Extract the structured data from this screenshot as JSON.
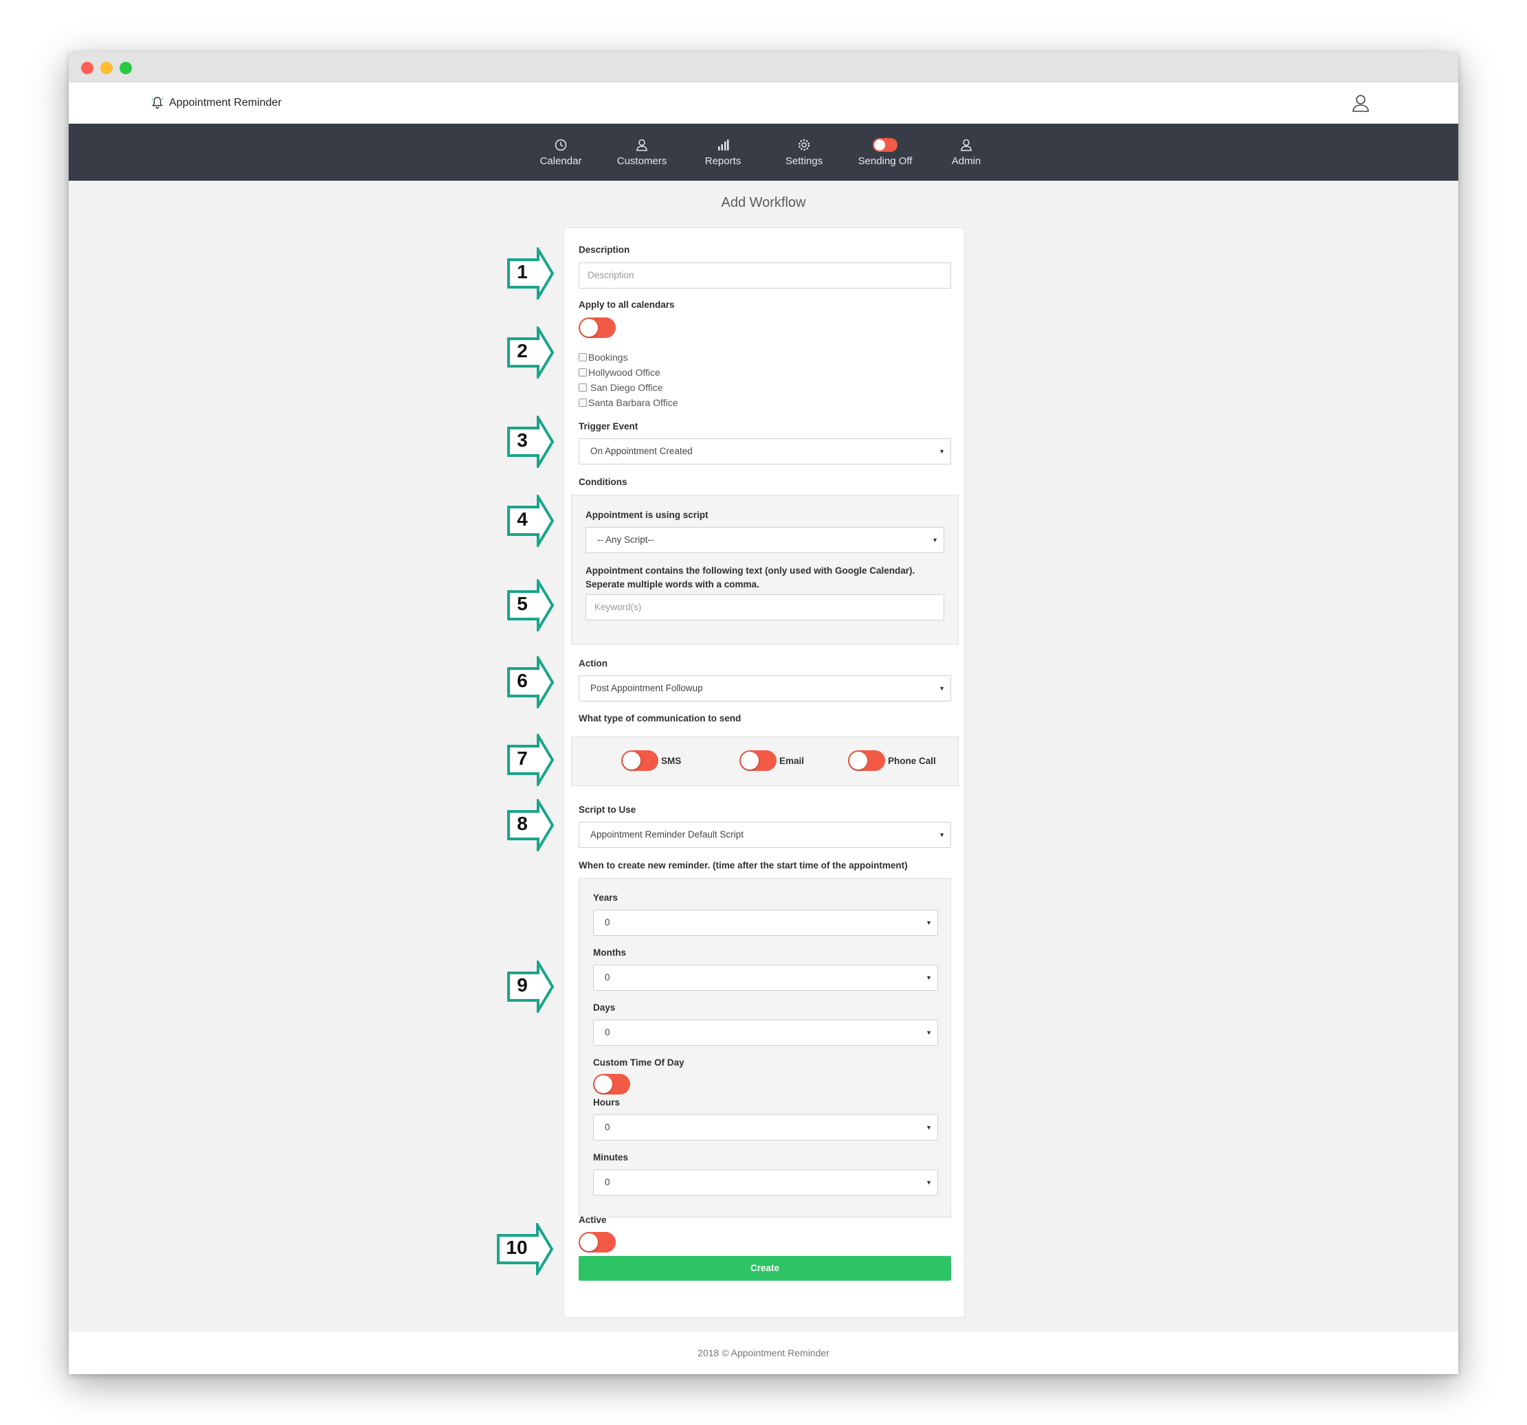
{
  "app": {
    "name": "Appointment Reminder"
  },
  "nav": {
    "items": [
      {
        "label": "Calendar"
      },
      {
        "label": "Customers"
      },
      {
        "label": "Reports"
      },
      {
        "label": "Settings"
      },
      {
        "label": "Sending Off"
      },
      {
        "label": "Admin"
      }
    ]
  },
  "page": {
    "title": "Add Workflow"
  },
  "form": {
    "description": {
      "label": "Description",
      "placeholder": "Description"
    },
    "apply_all": {
      "label": "Apply to all calendars"
    },
    "calendars": [
      "Bookings",
      "Hollywood Office",
      "San Diego Office",
      "Santa Barbara Office"
    ],
    "trigger": {
      "label": "Trigger Event",
      "value": "On Appointment Created"
    },
    "conditions": {
      "label": "Conditions",
      "script_label": "Appointment is using script",
      "script_value": "-- Any Script--",
      "text_label_line1": "Appointment contains the following text (only used with Google Calendar).",
      "text_label_line2": "Seperate multiple words with a comma.",
      "keyword_placeholder": "Keyword(s)"
    },
    "action": {
      "label": "Action",
      "value": "Post Appointment Followup"
    },
    "communication": {
      "label": "What type of communication to send",
      "options": [
        "SMS",
        "Email",
        "Phone Call"
      ]
    },
    "script": {
      "label": "Script to Use",
      "value": "Appointment Reminder Default Script"
    },
    "timing": {
      "label": "When to create new reminder. (time after the start time of the appointment)",
      "years": {
        "label": "Years",
        "value": "0"
      },
      "months": {
        "label": "Months",
        "value": "0"
      },
      "days": {
        "label": "Days",
        "value": "0"
      },
      "custom_time": {
        "label": "Custom Time Of Day"
      },
      "hours": {
        "label": "Hours",
        "value": "0"
      },
      "minutes": {
        "label": "Minutes",
        "value": "0"
      }
    },
    "active": {
      "label": "Active"
    },
    "create_label": "Create"
  },
  "footer": {
    "text": "2018 © Appointment Reminder"
  },
  "callouts": [
    "1",
    "2",
    "3",
    "4",
    "5",
    "6",
    "7",
    "8",
    "9",
    "10"
  ],
  "colors": {
    "toggle": "#f25a45",
    "create": "#2dc463",
    "nav_bg": "#373c47",
    "callout": "#1aa58a"
  }
}
